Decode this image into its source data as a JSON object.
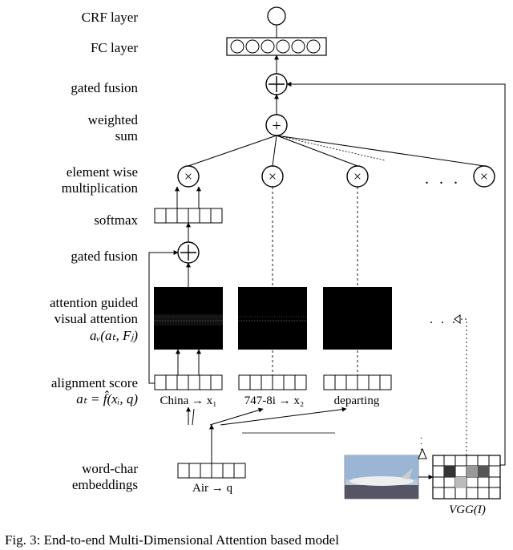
{
  "labels": {
    "crf": "CRF layer",
    "fc": "FC layer",
    "gated_fusion_top": "gated fusion",
    "weighted_sum_l1": "weighted",
    "weighted_sum_l2": "sum",
    "element_wise_l1": "element wise",
    "element_wise_l2": "multiplication",
    "softmax": "softmax",
    "gated_fusion_mid": "gated fusion",
    "att_guided_l1": "attention guided",
    "att_guided_l2": "visual attention",
    "att_guided_l3": "aᵥ(aₜ, Fⱼ)",
    "alignment_l1": "alignment score",
    "alignment_l2": "aₜ = f̂(xᵢ, q)",
    "word_char_l1": "word-char",
    "word_char_l2": "embeddings"
  },
  "tokens": {
    "x1": "China → x₁",
    "x2": "747-8i → x₂",
    "x3": "departing",
    "q": "Air → q",
    "vgg": "VGG(I)"
  },
  "ops": {
    "mult": "×",
    "plus": "+",
    "oplus": "⊕",
    "dots": ". . .",
    "dots_small": ". . .",
    "tri_dots": "⋮"
  },
  "caption": "Fig. 3: End-to-end Multi-Dimensional Attention based model"
}
